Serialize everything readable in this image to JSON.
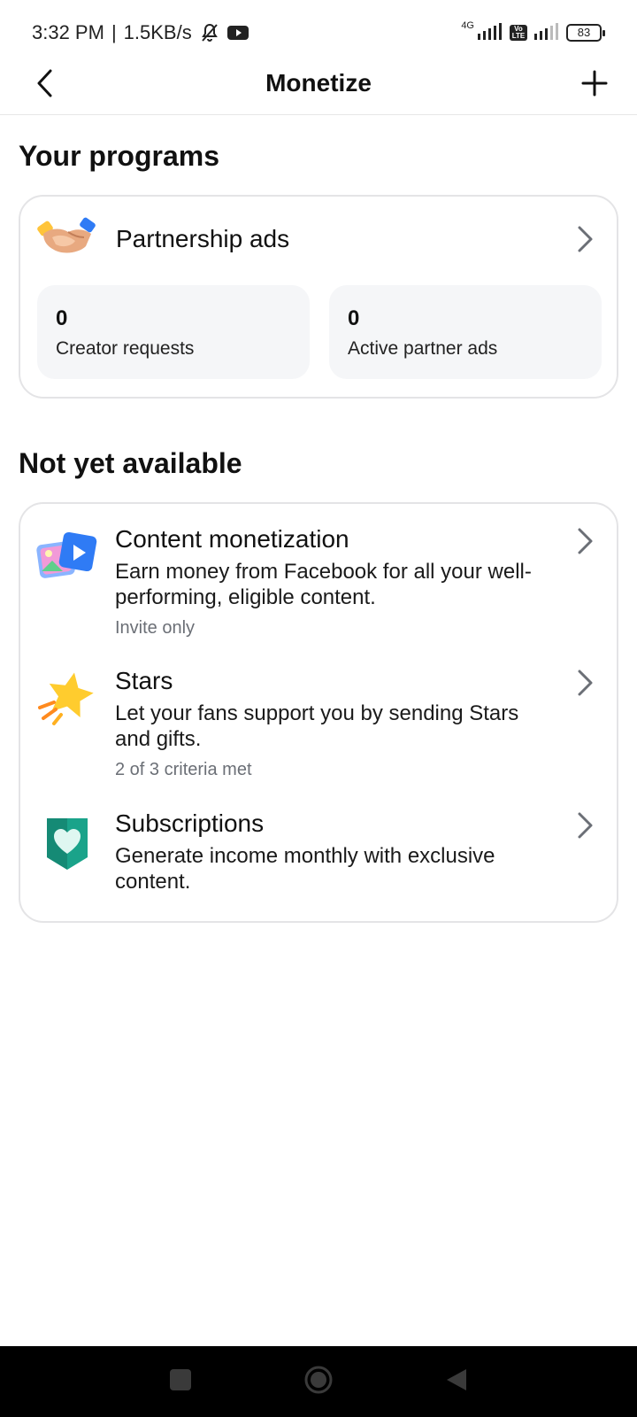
{
  "status_bar": {
    "time": "3:32 PM",
    "separator": "|",
    "speed": "1.5KB/s",
    "network_label": "4G",
    "volte_label": "Vo LTE",
    "battery": "83",
    "icons": [
      "bell-off-icon",
      "youtube-icon",
      "signal-icon",
      "volte-icon",
      "signal-icon",
      "battery-icon"
    ]
  },
  "header": {
    "title": "Monetize",
    "back_icon": "chevron-left-icon",
    "add_icon": "plus-icon"
  },
  "programs": {
    "section_title": "Your programs",
    "item": {
      "title": "Partnership ads",
      "icon": "handshake-icon"
    },
    "stats": [
      {
        "value": "0",
        "label": "Creator requests"
      },
      {
        "value": "0",
        "label": "Active partner ads"
      }
    ]
  },
  "not_available": {
    "section_title": "Not yet available",
    "items": [
      {
        "title": "Content monetization",
        "description": "Earn money from Facebook for all your well-performing, eligible content.",
        "meta": "Invite only",
        "icon": "content-media-icon"
      },
      {
        "title": "Stars",
        "description": "Let your fans support you by sending Stars and gifts.",
        "meta": "2 of 3 criteria met",
        "icon": "star-icon"
      },
      {
        "title": "Subscriptions",
        "description": "Generate income monthly with exclusive content.",
        "icon": "heart-shield-icon"
      }
    ]
  },
  "nav_bar": {
    "buttons": [
      "recent-apps-icon",
      "home-icon",
      "back-triangle-icon"
    ]
  },
  "colors": {
    "card_border": "#e4e4e6",
    "stat_bg": "#f5f6f8",
    "meta_text": "#6b6f76",
    "subscriptions_green": "#1aa38a",
    "star_yellow": "#ffcc2e",
    "content_blue": "#2f7bf5"
  }
}
